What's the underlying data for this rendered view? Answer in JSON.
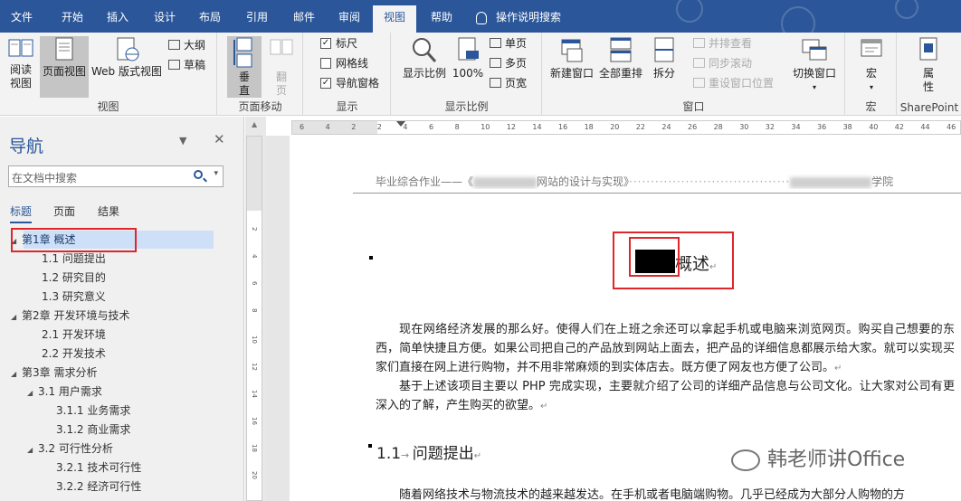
{
  "tabs": [
    "文件",
    "开始",
    "插入",
    "设计",
    "布局",
    "引用",
    "邮件",
    "审阅",
    "视图",
    "帮助"
  ],
  "active_tab": "视图",
  "tell_me": "操作说明搜索",
  "ribbon": {
    "views": {
      "label": "视图",
      "read_mode": "阅读视图",
      "print_layout": "页面视图",
      "web_layout": "Web 版式视图",
      "outline": "大纲",
      "draft": "草稿"
    },
    "page_movement": {
      "label": "页面移动",
      "vertical": "垂直",
      "side_to_side": "翻页"
    },
    "show": {
      "label": "显示",
      "ruler": "标尺",
      "ruler_checked": true,
      "gridlines": "网格线",
      "gridlines_checked": false,
      "nav_pane": "导航窗格",
      "nav_pane_checked": true
    },
    "zoom": {
      "label": "显示比例",
      "zoom": "显示比例",
      "hundred": "100%",
      "one_page": "单页",
      "multi_page": "多页",
      "page_width": "页宽"
    },
    "window": {
      "label": "窗口",
      "new_window": "新建窗口",
      "arrange_all": "全部重排",
      "split": "拆分",
      "side_by_side": "并排查看",
      "sync_scroll": "同步滚动",
      "reset_pos": "重设窗口位置",
      "switch": "切换窗口"
    },
    "macros": {
      "label": "宏",
      "macros": "宏"
    },
    "sharepoint": {
      "label": "SharePoint",
      "properties": "属性"
    }
  },
  "nav": {
    "title": "导航",
    "search_placeholder": "在文档中搜索",
    "tabs": [
      "标题",
      "页面",
      "结果"
    ],
    "active_tab": "标题",
    "tree": [
      {
        "label": "第1章 概述",
        "level": 1,
        "expanded": true,
        "selected": true
      },
      {
        "label": "1.1 问题提出",
        "level": 2
      },
      {
        "label": "1.2 研究目的",
        "level": 2
      },
      {
        "label": "1.3 研究意义",
        "level": 2
      },
      {
        "label": "第2章 开发环境与技术",
        "level": 1,
        "expanded": true
      },
      {
        "label": "2.1 开发环境",
        "level": 2
      },
      {
        "label": "2.2 开发技术",
        "level": 2
      },
      {
        "label": "第3章 需求分析",
        "level": 1,
        "expanded": true
      },
      {
        "label": "3.1 用户需求",
        "level": 2,
        "expanded": true
      },
      {
        "label": "3.1.1 业务需求",
        "level": 3
      },
      {
        "label": "3.1.2 商业需求",
        "level": 3
      },
      {
        "label": "3.2 可行性分析",
        "level": 2,
        "expanded": true
      },
      {
        "label": "3.2.1 技术可行性",
        "level": 3
      },
      {
        "label": "3.2.2 经济可行性",
        "level": 3
      }
    ]
  },
  "ruler": {
    "h_numbers": [
      "6",
      "4",
      "2",
      "2",
      "4",
      "6",
      "8",
      "10",
      "12",
      "14",
      "16",
      "18",
      "20",
      "22",
      "24",
      "26",
      "28",
      "30",
      "32",
      "34",
      "36",
      "38",
      "40",
      "42",
      "44",
      "46"
    ],
    "v_numbers": [
      "2",
      "4",
      "6",
      "8",
      "10",
      "12",
      "14",
      "16",
      "18",
      "20"
    ]
  },
  "document": {
    "header_prefix": "毕业综合作业——《",
    "header_mid": "网站的设计与实现》",
    "header_suffix": "学院",
    "chapter_title": "概述",
    "para1": "现在网络经济发展的那么好。使得人们在上班之余还可以拿起手机或电脑来浏览网页。购买自己想要的东西，简单快捷且方便。如果公司把自己的产品放到网站上面去，把产品的详细信息都展示给大家。就可以实现买家们直接在网上进行购物，并不用非常麻烦的到实体店去。既方便了网友也方便了公司。",
    "para2": "基于上述该项目主要以 PHP 完成实现，主要就介绍了公司的详细产品信息与公司文化。让大家对公司有更深入的了解，产生购买的欲望。",
    "heading_num": "1.1",
    "heading_text": "问题提出",
    "para3": "随着网络技术与物流技术的越来越发达。在手机或者电脑端购物。几乎已经成为大部分人购物的方"
  },
  "watermark": "韩老师讲Office"
}
